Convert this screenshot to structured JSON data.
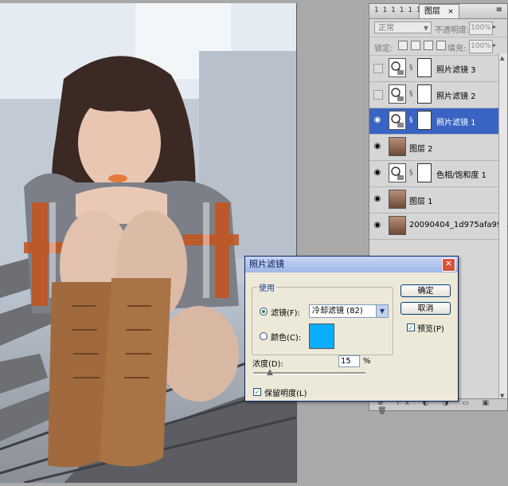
{
  "layers_panel": {
    "mini_tabs": "1 1 1 1 1 1 1 1",
    "active_tab": "图层",
    "tab_close": "×",
    "menu_arrow": "≡",
    "blend_mode": "正常",
    "opacity_label": "不透明度:",
    "opacity_value": "100%",
    "lock_label": "锁定:",
    "fill_label": "填充:",
    "fill_value": "100%",
    "footer_icons": "⊕ fx ◐ ◑ ▭ ▣ 🗑",
    "layers": [
      {
        "name": "照片滤镜 3",
        "visible": false,
        "selected": false,
        "kind": "adjustment"
      },
      {
        "name": "照片滤镜 2",
        "visible": false,
        "selected": false,
        "kind": "adjustment"
      },
      {
        "name": "照片滤镜 1",
        "visible": true,
        "selected": true,
        "kind": "adjustment"
      },
      {
        "name": "图层 2",
        "visible": true,
        "selected": false,
        "kind": "photo"
      },
      {
        "name": "色相/饱和度 1",
        "visible": true,
        "selected": false,
        "kind": "adjustment"
      },
      {
        "name": "图层 1",
        "visible": true,
        "selected": false,
        "kind": "photo"
      },
      {
        "name": "20090404_1d975afa99...",
        "visible": true,
        "selected": false,
        "kind": "photo"
      }
    ]
  },
  "dialog": {
    "title": "照片滤镜",
    "close_glyph": "✕",
    "group_label": "使用",
    "filter_radio_label": "滤镜(F):",
    "filter_value": "冷却滤镜 (82)",
    "color_radio_label": "颜色(C):",
    "swatch_color": "#0aaeff",
    "ok_label": "确定",
    "cancel_label": "取消",
    "preview_label": "预览(P)",
    "density_label": "浓度(D):",
    "density_value": "15",
    "density_unit": "%",
    "density_fraction": 0.15,
    "preserve_label": "保留明度(L)",
    "check_glyph": "✓"
  },
  "icons": {
    "eye": "eye-icon",
    "chain": "link-icon",
    "dropdown": "chevron-down-icon"
  }
}
